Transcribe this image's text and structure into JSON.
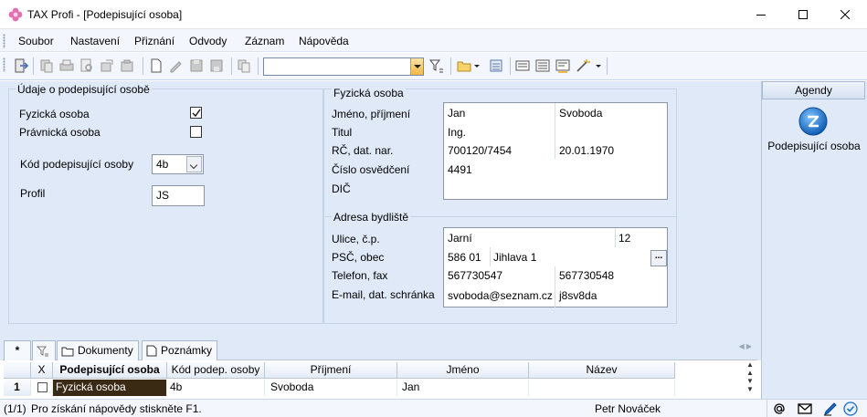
{
  "window": {
    "title": "TAX Profi - [Podepisující osoba]"
  },
  "menu": [
    "Soubor",
    "Nastavení",
    "Přiznání",
    "Odvody",
    "Záznam",
    "Nápověda"
  ],
  "toolbar": {
    "search_value": ""
  },
  "left_group": {
    "title": "Údaje o podepisující osobě",
    "fyzicka_label": "Fyzická osoba",
    "fyzicka_checked": true,
    "pravnicka_label": "Právnická osoba",
    "pravnicka_checked": false,
    "kod_label": "Kód podepisující osoby",
    "kod_value": "4b",
    "profil_label": "Profil",
    "profil_value": "JS"
  },
  "fyzicka_osoba": {
    "title": "Fyzická osoba",
    "jmeno_label": "Jméno, příjmení",
    "jmeno": "Jan",
    "prijmeni": "Svoboda",
    "titul_label": "Titul",
    "titul": "Ing.",
    "rc_label": "RČ, dat. nar.",
    "rc": "700120/7454",
    "dat_nar": "20.01.1970",
    "osvedceni_label": "Číslo osvědčení",
    "osvedceni": "4491",
    "dic_label": "DIČ",
    "dic": ""
  },
  "adresa": {
    "title": "Adresa bydliště",
    "ulice_label": "Ulice, č.p.",
    "ulice": "Jarní",
    "cp": "12",
    "psc_label": "PSČ, obec",
    "psc": "586 01",
    "obec": "Jihlava 1",
    "browse_label": "...",
    "telefon_label": "Telefon, fax",
    "telefon": "567730547",
    "fax": "567730548",
    "email_label": "E-mail, dat. schránka",
    "email": "svoboda@seznam.cz",
    "schranka": "j8sv8da"
  },
  "agenda": {
    "header": "Agendy",
    "item": "Podepisující osoba"
  },
  "tabs": {
    "star": "*",
    "dokumenty": "Dokumenty",
    "poznamky": "Poznámky"
  },
  "grid": {
    "headers": [
      "X",
      "Podepisující osoba",
      "Kód podep. osoby",
      "Příjmení",
      "Jméno",
      "Název"
    ],
    "row": {
      "num": "1",
      "x": "",
      "osoba": "Fyzická osoba",
      "kod": "4b",
      "prijmeni": "Svoboda",
      "jmeno": "Jan",
      "nazev": ""
    }
  },
  "status": {
    "record": "(1/1)",
    "hint": "Pro získání nápovědy stiskněte F1.",
    "user": "Petr Nováček"
  },
  "colors": {
    "accent": "#1c6fc5",
    "panel_bg": "#dfe9f7",
    "selected_cell_bg": "#3a2a14"
  }
}
